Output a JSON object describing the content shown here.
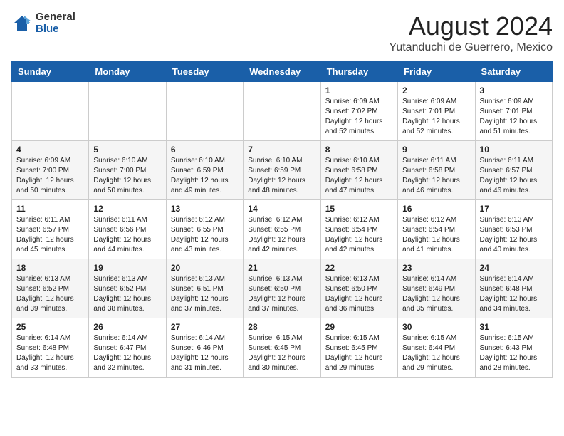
{
  "header": {
    "logo_general": "General",
    "logo_blue": "Blue",
    "month_title": "August 2024",
    "location": "Yutanduchi de Guerrero, Mexico"
  },
  "days_of_week": [
    "Sunday",
    "Monday",
    "Tuesday",
    "Wednesday",
    "Thursday",
    "Friday",
    "Saturday"
  ],
  "weeks": [
    [
      {
        "day": "",
        "info": ""
      },
      {
        "day": "",
        "info": ""
      },
      {
        "day": "",
        "info": ""
      },
      {
        "day": "",
        "info": ""
      },
      {
        "day": "1",
        "info": "Sunrise: 6:09 AM\nSunset: 7:02 PM\nDaylight: 12 hours and 52 minutes."
      },
      {
        "day": "2",
        "info": "Sunrise: 6:09 AM\nSunset: 7:01 PM\nDaylight: 12 hours and 52 minutes."
      },
      {
        "day": "3",
        "info": "Sunrise: 6:09 AM\nSunset: 7:01 PM\nDaylight: 12 hours and 51 minutes."
      }
    ],
    [
      {
        "day": "4",
        "info": "Sunrise: 6:09 AM\nSunset: 7:00 PM\nDaylight: 12 hours and 50 minutes."
      },
      {
        "day": "5",
        "info": "Sunrise: 6:10 AM\nSunset: 7:00 PM\nDaylight: 12 hours and 50 minutes."
      },
      {
        "day": "6",
        "info": "Sunrise: 6:10 AM\nSunset: 6:59 PM\nDaylight: 12 hours and 49 minutes."
      },
      {
        "day": "7",
        "info": "Sunrise: 6:10 AM\nSunset: 6:59 PM\nDaylight: 12 hours and 48 minutes."
      },
      {
        "day": "8",
        "info": "Sunrise: 6:10 AM\nSunset: 6:58 PM\nDaylight: 12 hours and 47 minutes."
      },
      {
        "day": "9",
        "info": "Sunrise: 6:11 AM\nSunset: 6:58 PM\nDaylight: 12 hours and 46 minutes."
      },
      {
        "day": "10",
        "info": "Sunrise: 6:11 AM\nSunset: 6:57 PM\nDaylight: 12 hours and 46 minutes."
      }
    ],
    [
      {
        "day": "11",
        "info": "Sunrise: 6:11 AM\nSunset: 6:57 PM\nDaylight: 12 hours and 45 minutes."
      },
      {
        "day": "12",
        "info": "Sunrise: 6:11 AM\nSunset: 6:56 PM\nDaylight: 12 hours and 44 minutes."
      },
      {
        "day": "13",
        "info": "Sunrise: 6:12 AM\nSunset: 6:55 PM\nDaylight: 12 hours and 43 minutes."
      },
      {
        "day": "14",
        "info": "Sunrise: 6:12 AM\nSunset: 6:55 PM\nDaylight: 12 hours and 42 minutes."
      },
      {
        "day": "15",
        "info": "Sunrise: 6:12 AM\nSunset: 6:54 PM\nDaylight: 12 hours and 42 minutes."
      },
      {
        "day": "16",
        "info": "Sunrise: 6:12 AM\nSunset: 6:54 PM\nDaylight: 12 hours and 41 minutes."
      },
      {
        "day": "17",
        "info": "Sunrise: 6:13 AM\nSunset: 6:53 PM\nDaylight: 12 hours and 40 minutes."
      }
    ],
    [
      {
        "day": "18",
        "info": "Sunrise: 6:13 AM\nSunset: 6:52 PM\nDaylight: 12 hours and 39 minutes."
      },
      {
        "day": "19",
        "info": "Sunrise: 6:13 AM\nSunset: 6:52 PM\nDaylight: 12 hours and 38 minutes."
      },
      {
        "day": "20",
        "info": "Sunrise: 6:13 AM\nSunset: 6:51 PM\nDaylight: 12 hours and 37 minutes."
      },
      {
        "day": "21",
        "info": "Sunrise: 6:13 AM\nSunset: 6:50 PM\nDaylight: 12 hours and 37 minutes."
      },
      {
        "day": "22",
        "info": "Sunrise: 6:13 AM\nSunset: 6:50 PM\nDaylight: 12 hours and 36 minutes."
      },
      {
        "day": "23",
        "info": "Sunrise: 6:14 AM\nSunset: 6:49 PM\nDaylight: 12 hours and 35 minutes."
      },
      {
        "day": "24",
        "info": "Sunrise: 6:14 AM\nSunset: 6:48 PM\nDaylight: 12 hours and 34 minutes."
      }
    ],
    [
      {
        "day": "25",
        "info": "Sunrise: 6:14 AM\nSunset: 6:48 PM\nDaylight: 12 hours and 33 minutes."
      },
      {
        "day": "26",
        "info": "Sunrise: 6:14 AM\nSunset: 6:47 PM\nDaylight: 12 hours and 32 minutes."
      },
      {
        "day": "27",
        "info": "Sunrise: 6:14 AM\nSunset: 6:46 PM\nDaylight: 12 hours and 31 minutes."
      },
      {
        "day": "28",
        "info": "Sunrise: 6:15 AM\nSunset: 6:45 PM\nDaylight: 12 hours and 30 minutes."
      },
      {
        "day": "29",
        "info": "Sunrise: 6:15 AM\nSunset: 6:45 PM\nDaylight: 12 hours and 29 minutes."
      },
      {
        "day": "30",
        "info": "Sunrise: 6:15 AM\nSunset: 6:44 PM\nDaylight: 12 hours and 29 minutes."
      },
      {
        "day": "31",
        "info": "Sunrise: 6:15 AM\nSunset: 6:43 PM\nDaylight: 12 hours and 28 minutes."
      }
    ]
  ]
}
